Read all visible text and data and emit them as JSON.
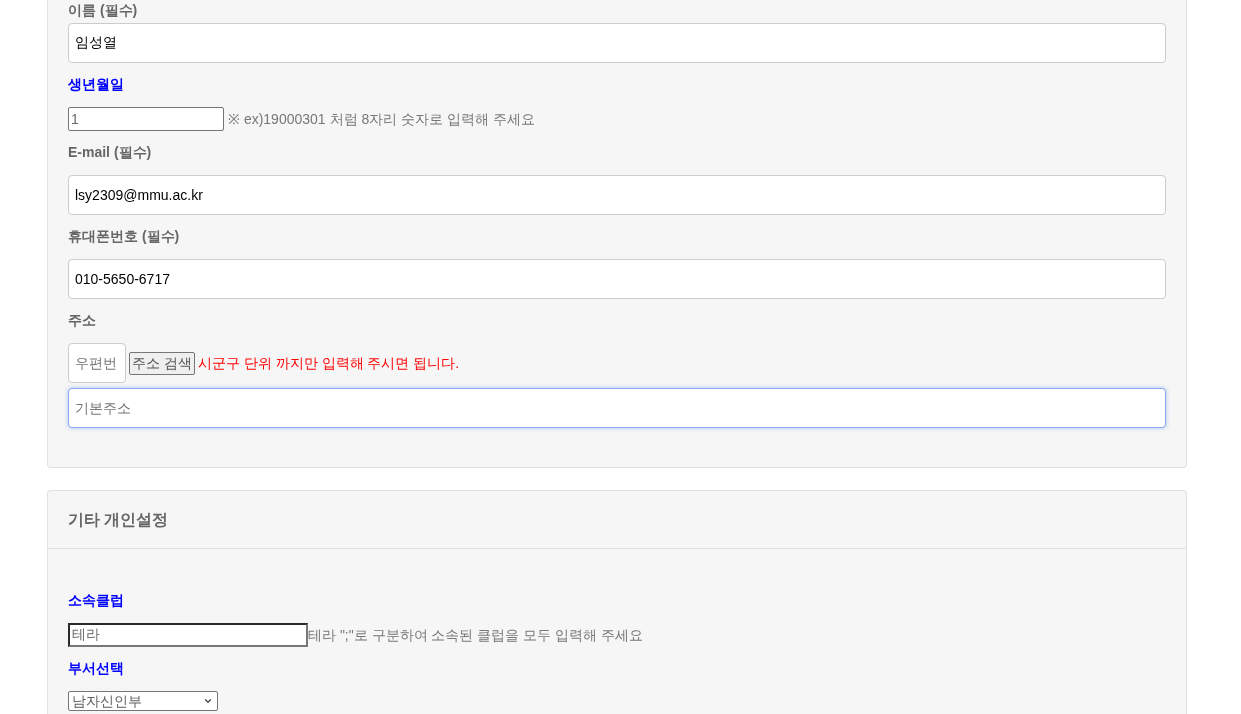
{
  "sections": [
    {
      "fields": [
        {
          "kind": "wide",
          "label": "이름 (필수)",
          "highlighted": false,
          "value": "임성열"
        },
        {
          "kind": "short",
          "label": "생년월일",
          "highlighted": true,
          "value": "1",
          "hint": "※ ex)19000301 처럼 8자리 숫자로 입력해 주세요"
        },
        {
          "kind": "wide",
          "label": "E-mail (필수)",
          "highlighted": false,
          "value": "lsy2309@mmu.ac.kr"
        },
        {
          "kind": "wide",
          "label": "휴대폰번호 (필수)",
          "highlighted": false,
          "value": "010-5650-6717"
        },
        {
          "kind": "address",
          "label": "주소",
          "highlighted": false,
          "postcode": {
            "placeholder": "우편번"
          },
          "search_button": "주소 검색",
          "note": "시군구 단위 까지만 입력해 주시면 됩니다.",
          "address": {
            "placeholder": "기본주소",
            "focused": true
          }
        }
      ]
    },
    {
      "title": "기타 개인설정",
      "fields": [
        {
          "kind": "inline",
          "label": "소속클럽",
          "highlighted": true,
          "value": "테라",
          "hint": "테라 \";\"로 구분하여 소속된 클럽을 모두 입력해 주세요"
        },
        {
          "kind": "select",
          "label": "부서선택",
          "highlighted": true,
          "value": "남자신인부"
        }
      ]
    }
  ]
}
